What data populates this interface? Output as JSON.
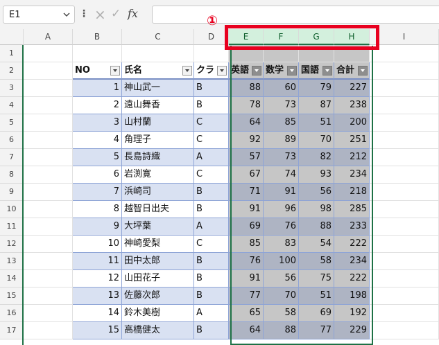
{
  "name_box": {
    "value": "E1"
  },
  "formula_bar": {
    "cancel_icon": "×",
    "enter_icon": "✓",
    "fx_label": "fx",
    "value": ""
  },
  "annotation": {
    "marker": "①"
  },
  "columns": [
    {
      "letter": "A",
      "selected": false
    },
    {
      "letter": "B",
      "selected": false
    },
    {
      "letter": "C",
      "selected": false
    },
    {
      "letter": "D",
      "selected": false
    },
    {
      "letter": "E",
      "selected": true
    },
    {
      "letter": "F",
      "selected": true
    },
    {
      "letter": "G",
      "selected": true
    },
    {
      "letter": "H",
      "selected": true
    },
    {
      "letter": "I",
      "selected": false
    }
  ],
  "row_numbers": [
    "1",
    "2",
    "3",
    "4",
    "5",
    "6",
    "7",
    "8",
    "9",
    "10",
    "11",
    "12",
    "13",
    "14",
    "15",
    "16",
    "17"
  ],
  "table": {
    "headers": [
      "NO",
      "氏名",
      "クラ",
      "英語",
      "数学",
      "国語",
      "合計"
    ],
    "rows": [
      [
        "1",
        "神山武一",
        "B",
        "88",
        "60",
        "79",
        "227"
      ],
      [
        "2",
        "遠山舞香",
        "B",
        "78",
        "73",
        "87",
        "238"
      ],
      [
        "3",
        "山村蘭",
        "C",
        "64",
        "85",
        "51",
        "200"
      ],
      [
        "4",
        "角理子",
        "C",
        "92",
        "89",
        "70",
        "251"
      ],
      [
        "5",
        "長島詩織",
        "A",
        "57",
        "73",
        "82",
        "212"
      ],
      [
        "6",
        "岩渕寛",
        "C",
        "67",
        "74",
        "93",
        "234"
      ],
      [
        "7",
        "浜崎司",
        "B",
        "71",
        "91",
        "56",
        "218"
      ],
      [
        "8",
        "越智日出夫",
        "B",
        "91",
        "96",
        "98",
        "285"
      ],
      [
        "9",
        "大坪葉",
        "A",
        "69",
        "76",
        "88",
        "233"
      ],
      [
        "10",
        "神崎愛梨",
        "C",
        "85",
        "83",
        "54",
        "222"
      ],
      [
        "11",
        "田中太郎",
        "B",
        "76",
        "100",
        "58",
        "234"
      ],
      [
        "12",
        "山田花子",
        "B",
        "91",
        "56",
        "75",
        "222"
      ],
      [
        "13",
        "佐藤次郎",
        "B",
        "77",
        "70",
        "51",
        "198"
      ],
      [
        "14",
        "鈴木美樹",
        "A",
        "65",
        "58",
        "69",
        "192"
      ],
      [
        "15",
        "高橋健太",
        "B",
        "64",
        "88",
        "77",
        "229"
      ]
    ]
  }
}
